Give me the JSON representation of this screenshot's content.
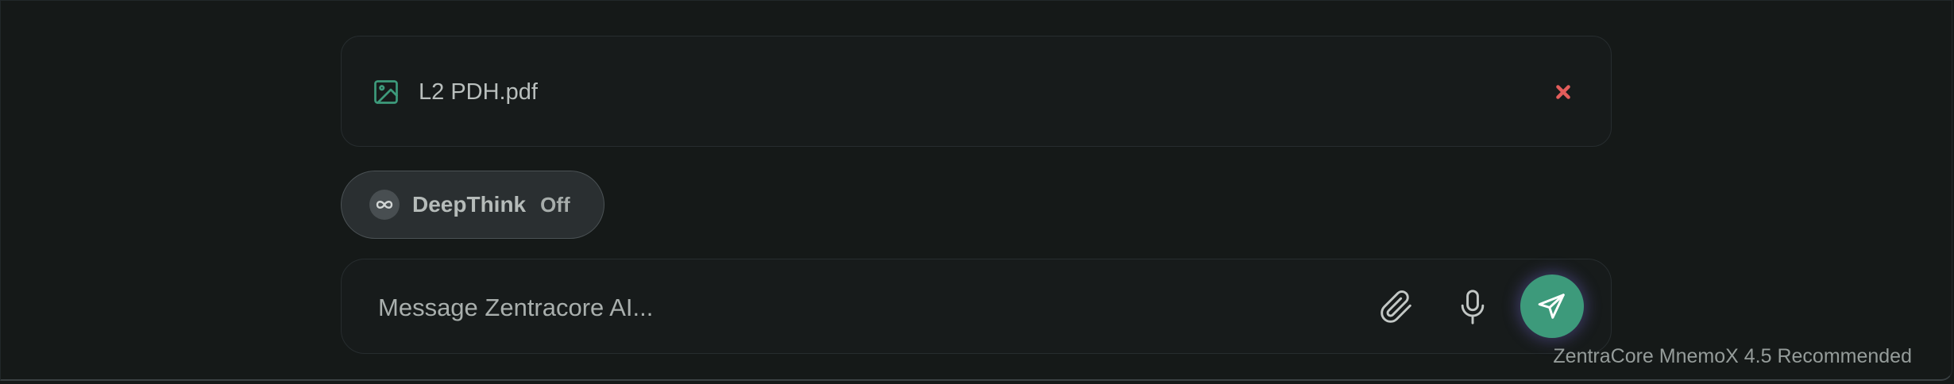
{
  "attachment": {
    "file_name": "L2 PDH.pdf",
    "icon": "image-file-icon",
    "remove_icon": "close-icon"
  },
  "deepthink": {
    "label": "DeepThink",
    "state": "Off",
    "icon": "infinity-icon"
  },
  "composer": {
    "placeholder": "Message Zentracore AI...",
    "attach_icon": "paperclip-icon",
    "mic_icon": "microphone-icon",
    "send_icon": "send-icon"
  },
  "model_note": "ZentraCore MnemoX 4.5 Recommended",
  "colors": {
    "background": "#151918",
    "accent": "#3d9a7b",
    "remove": "#e35d5b",
    "text": "#b9bfbd"
  }
}
